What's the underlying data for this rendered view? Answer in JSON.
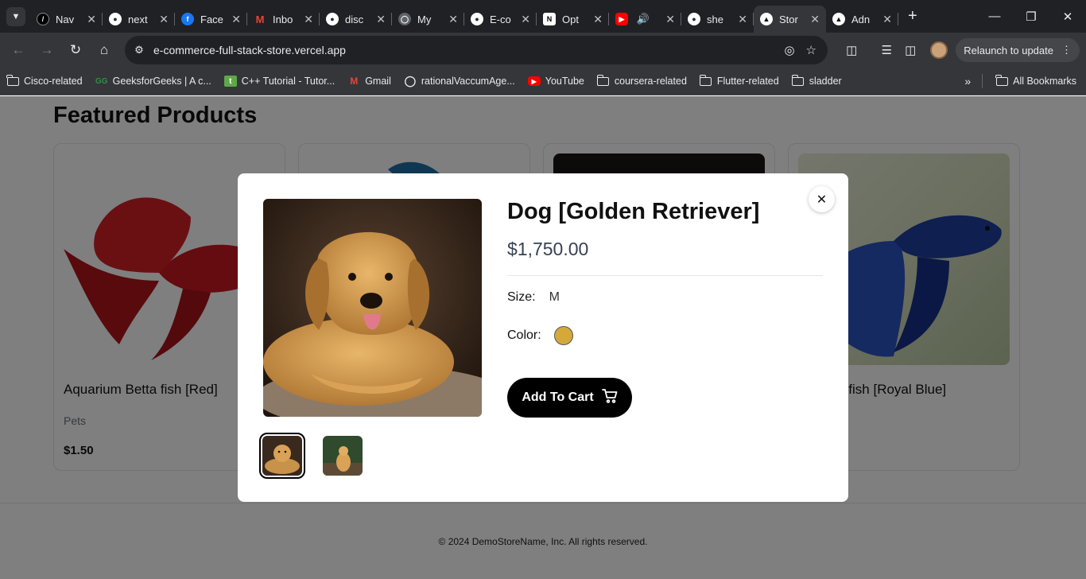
{
  "browser": {
    "tabs": [
      {
        "label": "Nav",
        "favicon": "vercel-next-icon",
        "color": "#000000"
      },
      {
        "label": "next",
        "favicon": "github-icon",
        "color": "#24292e"
      },
      {
        "label": "Face",
        "favicon": "facebook-icon",
        "color": "#1877f2"
      },
      {
        "label": "Inbo",
        "favicon": "gmail-icon",
        "color": "#ea4335"
      },
      {
        "label": "disc",
        "favicon": "github-icon",
        "color": "#24292e"
      },
      {
        "label": "My",
        "favicon": "globe-icon",
        "color": "#5f6368"
      },
      {
        "label": "E-co",
        "favicon": "github-icon",
        "color": "#24292e"
      },
      {
        "label": "Opt",
        "favicon": "notion-icon",
        "color": "#000000"
      },
      {
        "label": "",
        "favicon": "youtube-icon",
        "color": "#ff0000"
      },
      {
        "label": "she",
        "favicon": "github-icon",
        "color": "#24292e"
      },
      {
        "label": "Stor",
        "favicon": "vercel-icon",
        "color": "#000000",
        "active": true
      },
      {
        "label": "Adn",
        "favicon": "vercel-icon",
        "color": "#000000"
      }
    ],
    "url": "e-commerce-full-stack-store.vercel.app",
    "relaunch_label": "Relaunch to update",
    "bookmarks": [
      {
        "label": "Cisco-related",
        "icon": "folder-icon"
      },
      {
        "label": "GeeksforGeeks | A c...",
        "icon": "gfg-icon"
      },
      {
        "label": "C++ Tutorial - Tutor...",
        "icon": "tutorial-icon"
      },
      {
        "label": "Gmail",
        "icon": "gmail-icon"
      },
      {
        "label": "rationalVaccumAge...",
        "icon": "globe-icon"
      },
      {
        "label": "YouTube",
        "icon": "youtube-icon"
      },
      {
        "label": "coursera-related",
        "icon": "folder-icon"
      },
      {
        "label": "Flutter-related",
        "icon": "folder-icon"
      },
      {
        "label": "sladder",
        "icon": "folder-icon"
      }
    ],
    "all_bookmarks_label": "All Bookmarks"
  },
  "page": {
    "section_title": "Featured Products",
    "products": [
      {
        "name": "Aquarium Betta fish [Red]",
        "category": "Pets",
        "price": "$1.50"
      },
      {
        "name": "",
        "category": "",
        "price": ""
      },
      {
        "name": "",
        "category": "",
        "price": ""
      },
      {
        "name": "m Betta fish [Royal Blue]",
        "category": "",
        "price": ""
      }
    ],
    "footer": "© 2024 DemoStoreName, Inc. All rights reserved."
  },
  "modal": {
    "title": "Dog [Golden Retriever]",
    "price": "$1,750.00",
    "size_label": "Size:",
    "size_value": "M",
    "color_label": "Color:",
    "color_value": "#d4a93a",
    "add_to_cart_label": "Add To Cart",
    "thumbnails": [
      {
        "icon": "golden-retriever-lying-image",
        "selected": true
      },
      {
        "icon": "golden-retriever-sitting-image",
        "selected": false
      }
    ]
  }
}
